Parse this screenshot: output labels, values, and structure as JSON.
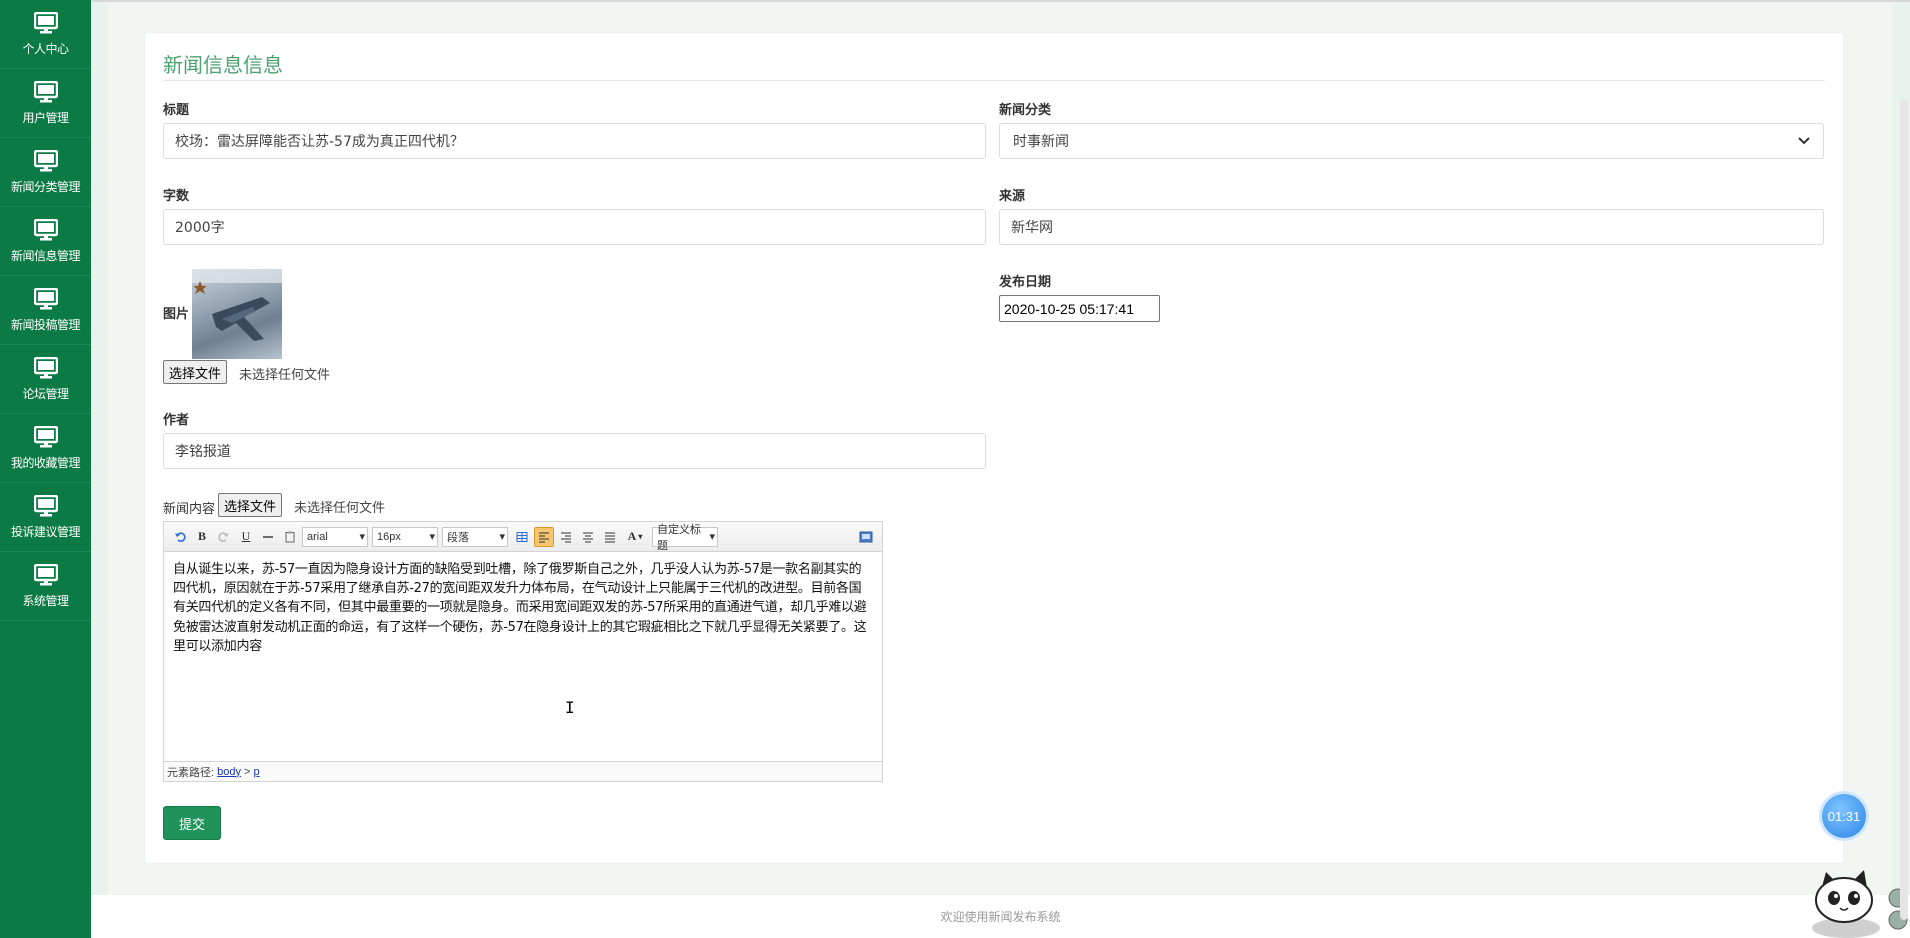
{
  "sidebar": {
    "items": [
      {
        "label": "个人中心"
      },
      {
        "label": "用户管理"
      },
      {
        "label": "新闻分类管理"
      },
      {
        "label": "新闻信息管理"
      },
      {
        "label": "新闻投稿管理"
      },
      {
        "label": "论坛管理"
      },
      {
        "label": "我的收藏管理"
      },
      {
        "label": "投诉建议管理"
      },
      {
        "label": "系统管理"
      }
    ]
  },
  "form": {
    "title": "新闻信息信息",
    "fields": {
      "headline": {
        "label": "标题",
        "value": "校场：雷达屏障能否让苏-57成为真正四代机？"
      },
      "category": {
        "label": "新闻分类",
        "value": "时事新闻"
      },
      "word_count": {
        "label": "字数",
        "value": "2000字"
      },
      "source": {
        "label": "来源",
        "value": "新华网"
      },
      "image": {
        "label": "图片",
        "button": "选择文件",
        "note": "未选择任何文件"
      },
      "publish_date": {
        "label": "发布日期",
        "value": "2020-10-25 05:17:41"
      },
      "author": {
        "label": "作者",
        "value": "李铭报道"
      },
      "content": {
        "label": "新闻内容",
        "button": "选择文件",
        "note": "未选择任何文件"
      }
    },
    "submit_label": "提交"
  },
  "editor": {
    "toolbar": {
      "bold": "B",
      "underline": "U",
      "font_family": "arial",
      "font_size": "16px",
      "paragraph": "段落",
      "custom_style": "自定义标题",
      "font_color": "A"
    },
    "content": "自从诞生以来，苏-57一直因为隐身设计方面的缺陷受到吐槽，除了俄罗斯自己之外，几乎没人认为苏-57是一款名副其实的四代机，原因就在于苏-57采用了继承自苏-27的宽间距双发升力体布局，在气动设计上只能属于三代机的改进型。目前各国有关四代机的定义各有不同，但其中最重要的一项就是隐身。而采用宽间距双发的苏-57所采用的直通进气道，却几乎难以避免被雷达波直射发动机正面的命运，有了这样一个硬伤，苏-57在隐身设计上的其它瑕疵相比之下就几乎显得无关紧要了。这里可以添加内容",
    "path_label": "元素路径:",
    "path_body": "body",
    "path_sep": ">",
    "path_p": "p"
  },
  "footer": {
    "text": "欢迎使用新闻发布系统"
  },
  "timer": {
    "text": "01:31"
  },
  "colors": {
    "sidebar": "#0b7a45",
    "accent": "#20935a",
    "title": "#4aa36f"
  }
}
